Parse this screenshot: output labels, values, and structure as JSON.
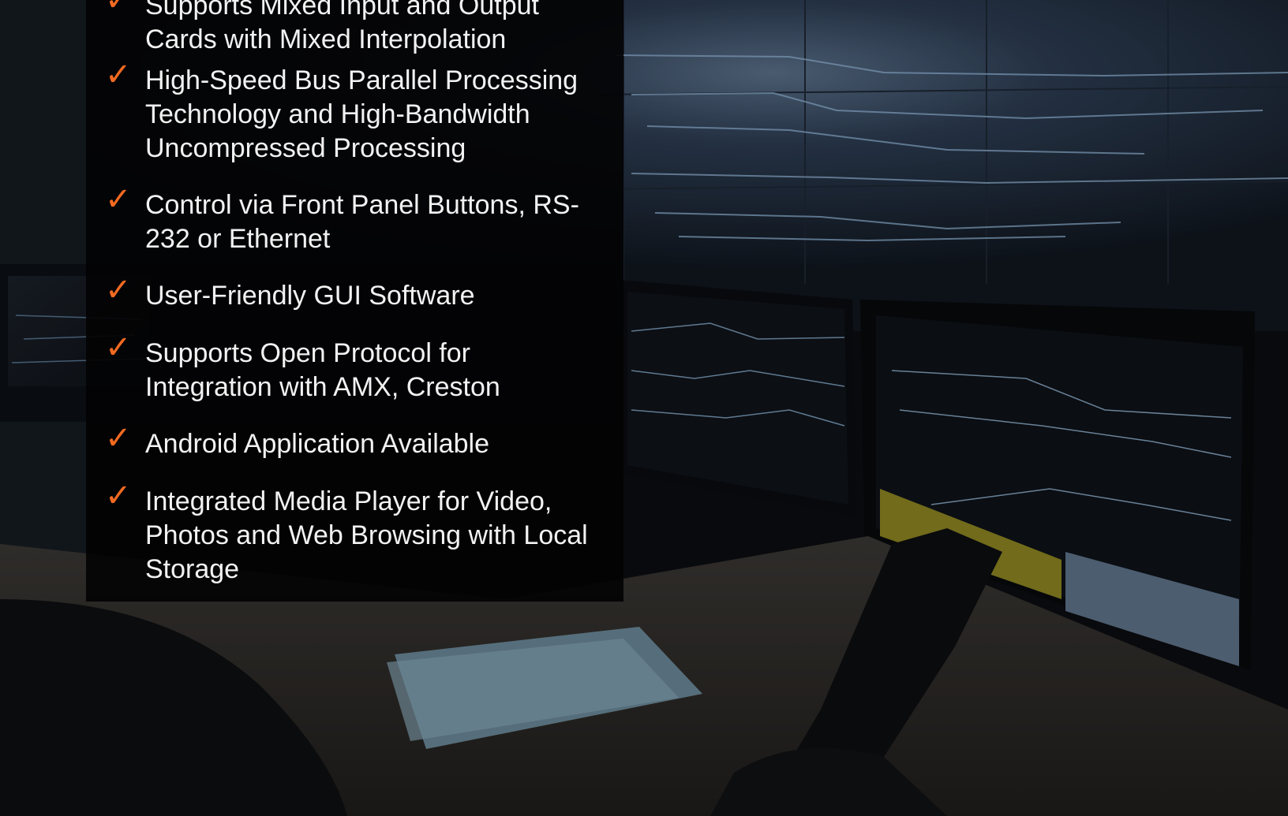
{
  "colors": {
    "check_accent": "#f26a21",
    "panel_background": "#040405",
    "text": "#f2f2f2"
  },
  "check_glyph": "✓",
  "features": [
    {
      "icon": "check-mark-icon",
      "text": "Supports Mixed Input and Output\nCards with Mixed Interpolation"
    },
    {
      "icon": "check-mark-icon",
      "text": "High-Speed Bus Parallel Processing\nTechnology and High-Bandwidth\nUncompressed Processing"
    },
    {
      "icon": "check-mark-icon",
      "text": "Control via Front Panel Buttons, RS-\n232 or Ethernet"
    },
    {
      "icon": "check-mark-icon",
      "text": "User-Friendly GUI Software"
    },
    {
      "icon": "check-mark-icon",
      "text": "Supports Open Protocol for\nIntegration with AMX, Creston"
    },
    {
      "icon": "check-mark-icon",
      "text": "Android Application Available"
    },
    {
      "icon": "check-mark-icon",
      "text": "Integrated Media Player for Video,\nPhotos and Web Browsing with Local\nStorage"
    }
  ]
}
